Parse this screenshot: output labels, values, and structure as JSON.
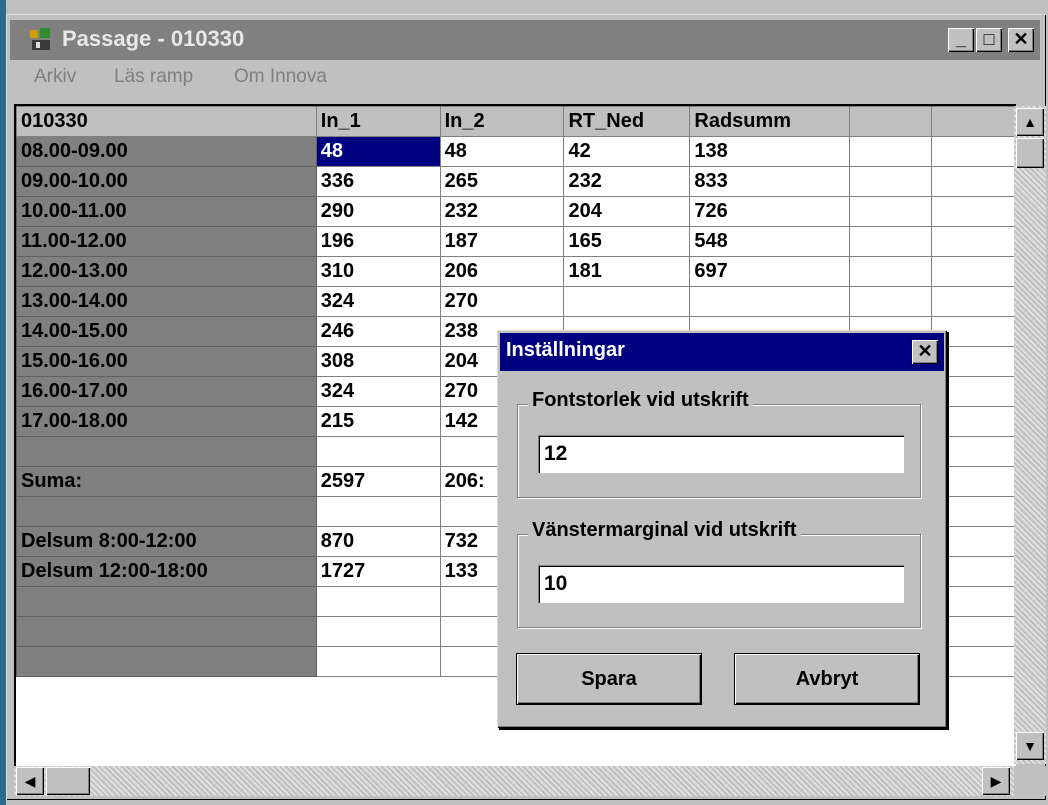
{
  "window": {
    "title": "Passage - 010330",
    "minimize": "_",
    "maximize": "□",
    "close": "✕"
  },
  "menu": [
    {
      "label": "Arkiv",
      "accel": "A"
    },
    {
      "label": "Läs ramp",
      "accel": "L"
    },
    {
      "label": "Om Innova",
      "accel": "O"
    }
  ],
  "sheet": {
    "headers": [
      "010330",
      "In_1",
      "In_2",
      "RT_Ned",
      "Radsumm",
      "",
      ""
    ],
    "rows": [
      [
        "08.00-09.00",
        "48",
        "48",
        "42",
        "138"
      ],
      [
        "09.00-10.00",
        "336",
        "265",
        "232",
        "833"
      ],
      [
        "10.00-11.00",
        "290",
        "232",
        "204",
        "726"
      ],
      [
        "11.00-12.00",
        "196",
        "187",
        "165",
        "548"
      ],
      [
        "12.00-13.00",
        "310",
        "206",
        "181",
        "697"
      ],
      [
        "13.00-14.00",
        "324",
        "270",
        "",
        ""
      ],
      [
        "14.00-15.00",
        "246",
        "238",
        "",
        ""
      ],
      [
        "15.00-16.00",
        "308",
        "204",
        "",
        ""
      ],
      [
        "16.00-17.00",
        "324",
        "270",
        "",
        ""
      ],
      [
        "17.00-18.00",
        "215",
        "142",
        "",
        ""
      ],
      [
        "",
        "",
        "",
        "",
        ""
      ],
      [
        "Suma:",
        "2597",
        "206:",
        "",
        ""
      ],
      [
        "",
        "",
        "",
        "",
        ""
      ],
      [
        "Delsum 8:00-12:00",
        "870",
        "732",
        "",
        ""
      ],
      [
        "Delsum 12:00-18:00",
        "1727",
        "133",
        "",
        ""
      ],
      [
        "",
        "",
        "",
        "",
        ""
      ],
      [
        "",
        "",
        "",
        "",
        ""
      ],
      [
        "",
        "",
        "",
        "",
        ""
      ]
    ]
  },
  "dialog": {
    "title": "Inställningar",
    "close": "✕",
    "font_group": "Fontstorlek vid utskrift",
    "font_value": "12",
    "margin_group": "Vänstermarginal vid utskrift",
    "margin_value": "10",
    "save": "Spara",
    "cancel": "Avbryt"
  },
  "colors": {
    "title_active": "#000080",
    "title_inactive": "#808080",
    "face": "#c0c0c0"
  }
}
